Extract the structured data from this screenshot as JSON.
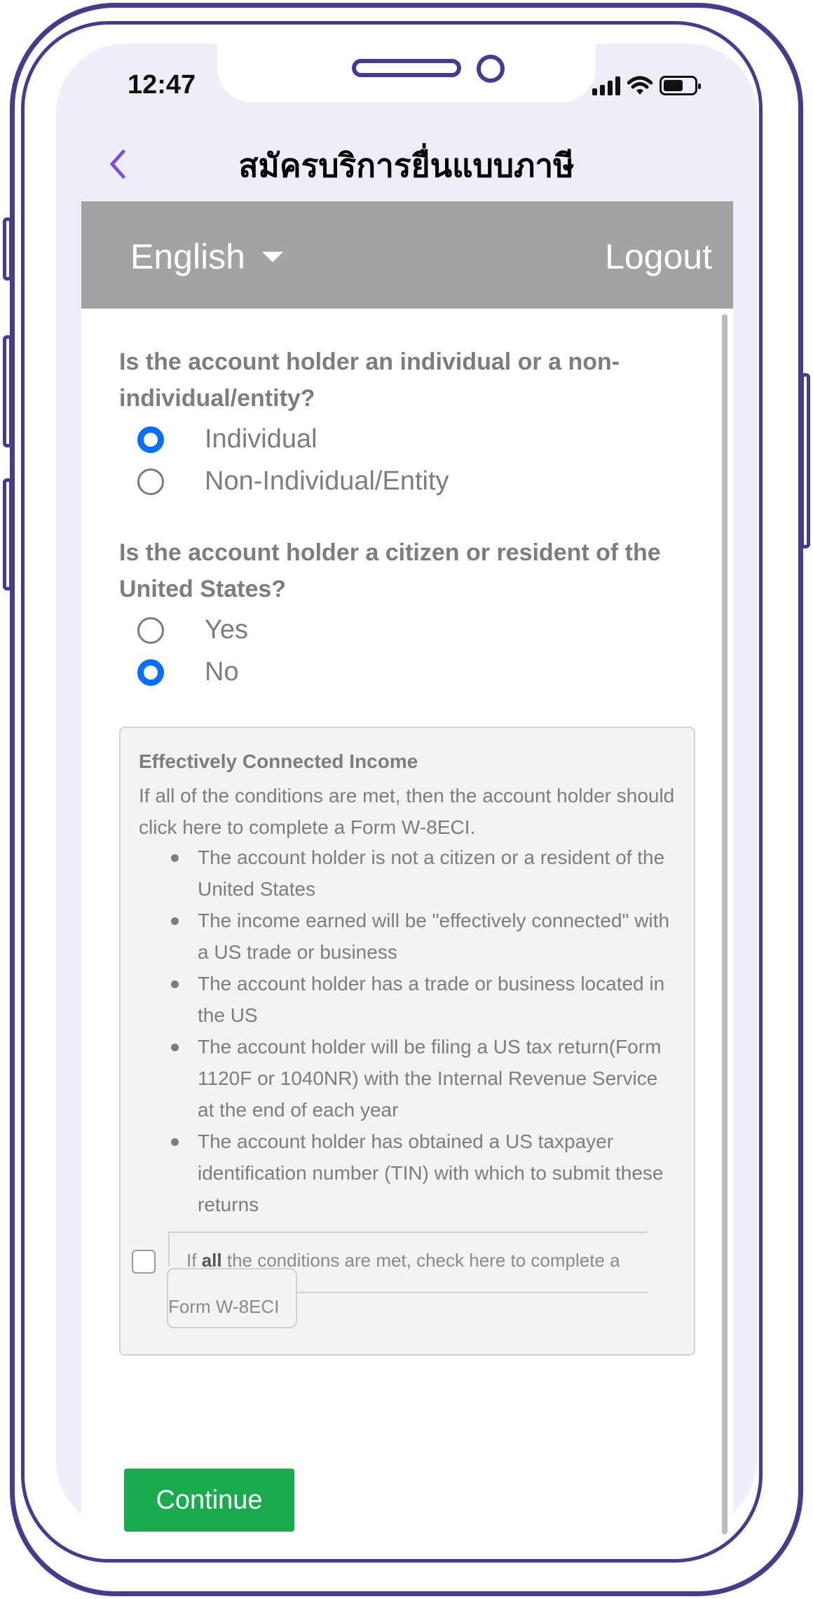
{
  "status_bar": {
    "time": "12:47"
  },
  "nav": {
    "title": "สมัครบริการยื่นแบบภาษี"
  },
  "header": {
    "language": "English",
    "logout": "Logout"
  },
  "questions": [
    {
      "text": "Is the account holder an individual or a non-individual/entity?",
      "options": [
        {
          "label": "Individual",
          "selected": true
        },
        {
          "label": "Non-Individual/Entity",
          "selected": false
        }
      ]
    },
    {
      "text": "Is the account holder a citizen or resident of the United States?",
      "options": [
        {
          "label": "Yes",
          "selected": false
        },
        {
          "label": "No",
          "selected": true
        }
      ]
    }
  ],
  "eci": {
    "title": "Effectively Connected Income",
    "intro": "If all of the conditions are met, then the account holder should click here to complete a Form W-8ECI.",
    "conditions": [
      "The account holder is not a citizen or a resident of the United States",
      "The income earned will be \"effectively connected\" with a US trade or business",
      "The account holder has a trade or business located in the US",
      "The account holder will be filing a US tax return(Form 1120F or 1040NR) with the Internal Revenue Service at the end of each year",
      "The account holder has obtained a US taxpayer identification number (TIN) with which to submit these returns"
    ],
    "checkbox_prefix": "If",
    "checkbox_bold": "all",
    "checkbox_suffix": "the conditions are met, check here to complete a",
    "form_label": "Form W-8ECI",
    "checked": false
  },
  "footer": {
    "continue": "Continue"
  },
  "colors": {
    "accent_blue": "#0a6ff7",
    "continue_green": "#1baa4e",
    "frame_purple": "#4a3a8c",
    "header_gray": "#a3a3a3"
  }
}
